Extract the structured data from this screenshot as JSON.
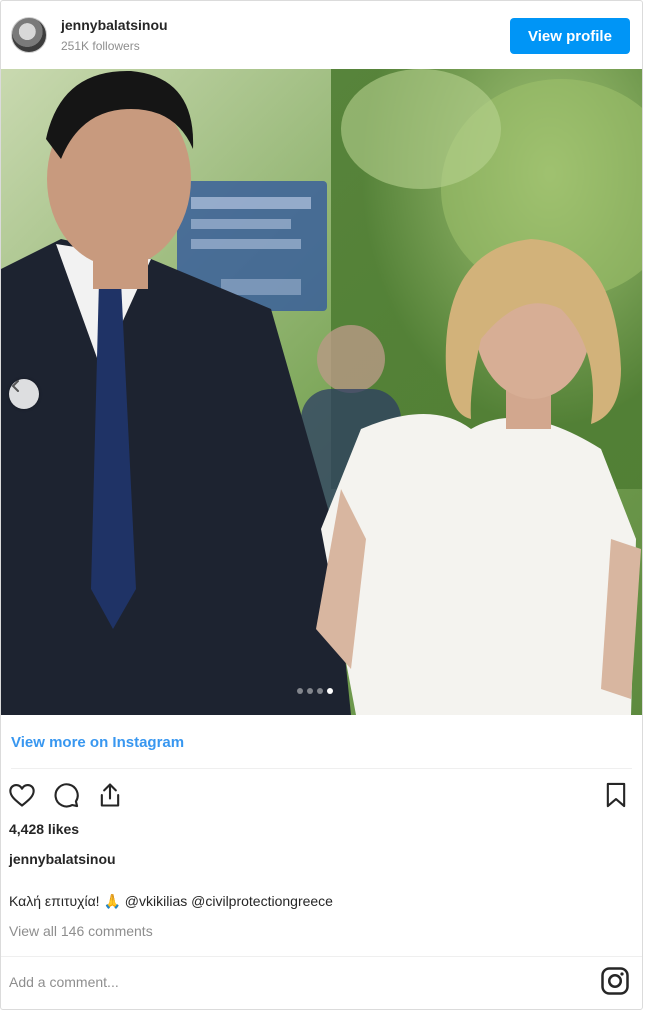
{
  "header": {
    "username": "jennybalatsinou",
    "followers": "251K followers",
    "view_profile_label": "View profile"
  },
  "post": {
    "carousel": {
      "total_slides": 4,
      "active_slide": 4
    },
    "view_more_label": "View more on Instagram",
    "likes": "4,428 likes",
    "author": "jennybalatsinou",
    "caption_text": "Καλή επιτυχία! 🙏",
    "mention_1": "@vkikilias",
    "mention_2": "@civilprotectiongreece",
    "view_comments": "View all 146 comments",
    "comment_placeholder": "Add a comment..."
  },
  "icons": {
    "like": "heart-icon",
    "comment": "comment-icon",
    "share": "share-icon",
    "save": "bookmark-icon",
    "instagram": "instagram-icon"
  },
  "colors": {
    "accent": "#0095f6",
    "link": "#3897f0",
    "muted": "#8e8e8e",
    "text": "#262626"
  }
}
